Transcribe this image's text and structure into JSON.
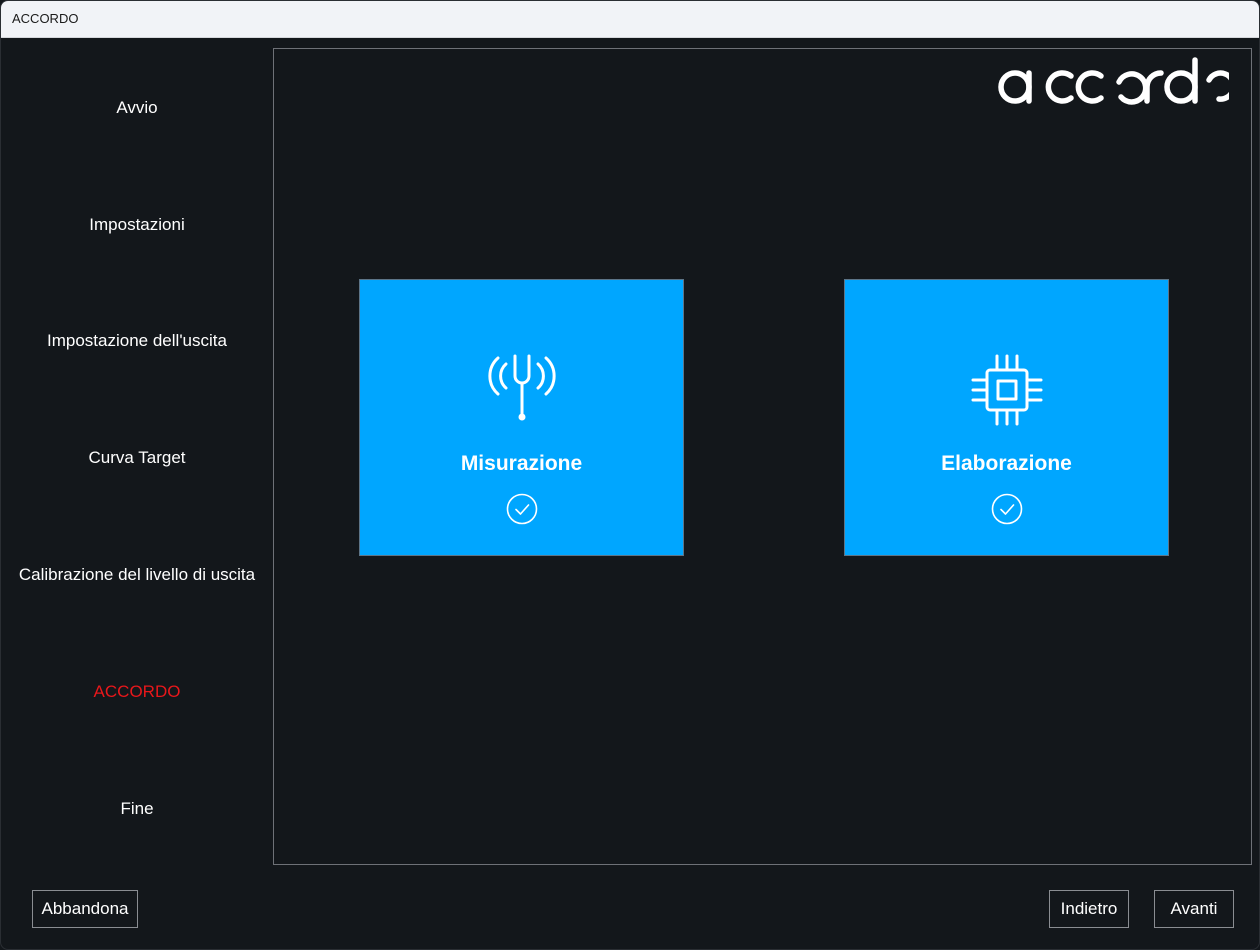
{
  "window": {
    "title": "ACCORDO"
  },
  "sidebar": {
    "items": [
      {
        "label": "Avvio",
        "active": false
      },
      {
        "label": "Impostazioni",
        "active": false
      },
      {
        "label": "Impostazione dell'uscita",
        "active": false
      },
      {
        "label": "Curva Target",
        "active": false
      },
      {
        "label": "Calibrazione del livello di uscita",
        "active": false
      },
      {
        "label": "ACCORDO",
        "active": true
      },
      {
        "label": "Fine",
        "active": false
      }
    ]
  },
  "main": {
    "logo": {
      "text": "accordo",
      "icon": "accordo-logo"
    },
    "cards": [
      {
        "label": "Misurazione",
        "icon": "tuning-fork-icon",
        "status_icon": "check-circle-icon",
        "completed": true
      },
      {
        "label": "Elaborazione",
        "icon": "cpu-chip-icon",
        "status_icon": "check-circle-icon",
        "completed": true
      }
    ]
  },
  "footer": {
    "abandon_label": "Abbandona",
    "back_label": "Indietro",
    "next_label": "Avanti"
  },
  "colors": {
    "background": "#13171b",
    "card": "#00a6ff",
    "active_nav": "#e8171b",
    "text": "#ffffff"
  }
}
